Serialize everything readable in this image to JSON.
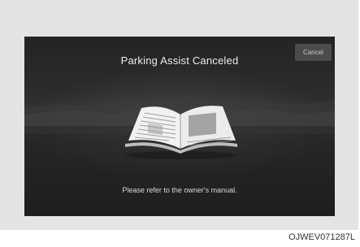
{
  "screen": {
    "title": "Parking Assist Canceled",
    "cancel_label": "Cancel",
    "message": "Please refer to the owner's manual.",
    "illustration_icon": "open-book-icon"
  },
  "figure_code": "OJWEV071287L",
  "colors": {
    "screen_background": "#2a2a2a",
    "title_text": "#ececec",
    "button_background": "#4b4b4b",
    "frame_background": "#e4e4e4"
  }
}
